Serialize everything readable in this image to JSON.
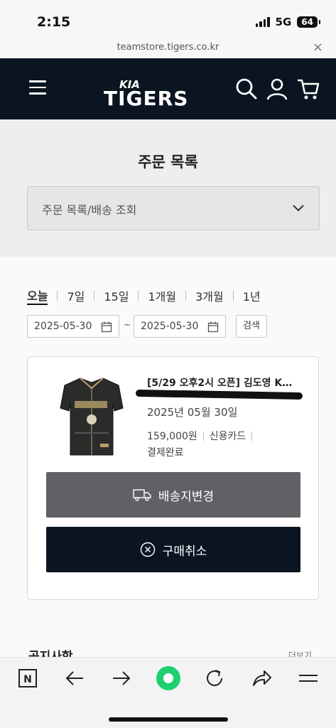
{
  "status_bar": {
    "time": "2:15",
    "network": "5G",
    "battery": "64"
  },
  "url_bar": {
    "url": "teamstore.tigers.co.kr",
    "close_symbol": "×"
  },
  "header": {
    "logo_text": "TIGERS",
    "logo_sub": "KIA",
    "icons": [
      "menu-icon",
      "search-icon",
      "user-icon",
      "cart-icon"
    ],
    "background_color": "#0b1522"
  },
  "page": {
    "title": "주문 목록",
    "select_value": "주문 목록/배송 조회"
  },
  "filters": {
    "period_tabs": [
      {
        "label": "오늘",
        "active": true
      },
      {
        "label": "7일",
        "active": false
      },
      {
        "label": "15일",
        "active": false
      },
      {
        "label": "1개월",
        "active": false
      },
      {
        "label": "3개월",
        "active": false
      },
      {
        "label": "1년",
        "active": false
      }
    ],
    "start_date": "2025-05-30",
    "end_date": "2025-05-30",
    "range_separator": "~",
    "search_label": "검색"
  },
  "order": {
    "product_name": "[5/29 오후2시 오픈] 김도영 K…",
    "order_date": "2025년 05월 30일",
    "price": "159,000원",
    "payment_method": "신용카드",
    "status": "결제완료",
    "change_address_label": "배송지변경",
    "cancel_label": "구매취소"
  },
  "below_fold": {
    "section_title": "공지사항",
    "more_label": "더보기"
  },
  "browser_bar": {
    "icons": [
      "naver-n-icon",
      "back-arrow-icon",
      "forward-arrow-icon",
      "green-dot-icon",
      "reload-icon",
      "share-icon",
      "menu-lines-icon"
    ],
    "n_label": "N",
    "accent_color": "#1fd070"
  }
}
